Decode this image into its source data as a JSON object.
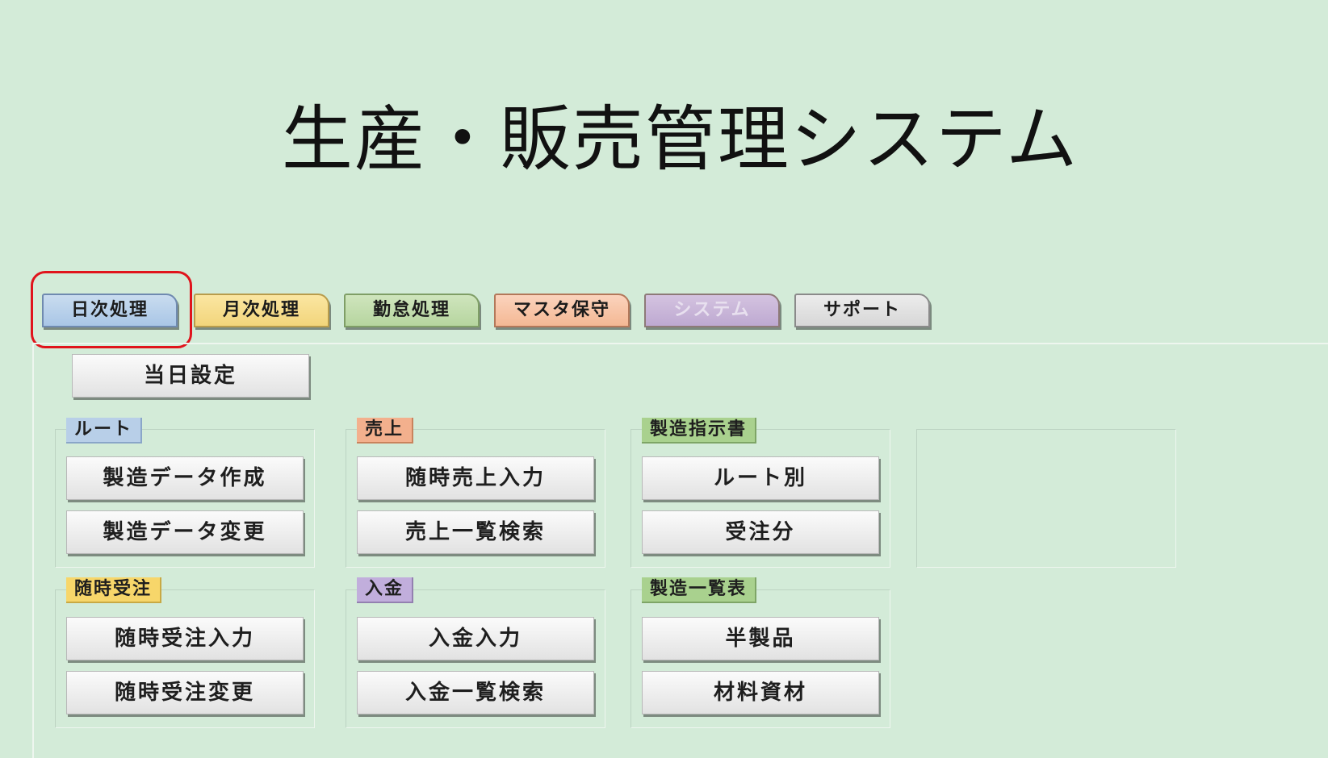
{
  "app": {
    "title": "生産・販売管理システム"
  },
  "tabs": [
    {
      "label": "日次処理"
    },
    {
      "label": "月次処理"
    },
    {
      "label": "勤怠処理"
    },
    {
      "label": "マスタ保守"
    },
    {
      "label": "システム"
    },
    {
      "label": "サポート"
    }
  ],
  "main": {
    "set_today_label": "当日設定",
    "groups": {
      "route": {
        "label": "ルート",
        "buttons": [
          "製造データ作成",
          "製造データ変更"
        ]
      },
      "sales": {
        "label": "売上",
        "buttons": [
          "随時売上入力",
          "売上一覧検索"
        ]
      },
      "manufacturing_instructions": {
        "label": "製造指示書",
        "buttons": [
          "ルート別",
          "受注分"
        ]
      },
      "ad_hoc_orders": {
        "label": "随時受注",
        "buttons": [
          "随時受注入力",
          "随時受注変更"
        ]
      },
      "payment": {
        "label": "入金",
        "buttons": [
          "入金入力",
          "入金一覧検索"
        ]
      },
      "manufacturing_list": {
        "label": "製造一覧表",
        "buttons": [
          "半製品",
          "材料資材"
        ]
      }
    }
  },
  "colors": {
    "background": "#d3ebd8",
    "highlight": "#e0141c",
    "tab_daily": "#b8cfe8",
    "tab_monthly": "#f7d66a",
    "tab_attendance": "#a9d18e",
    "tab_master": "#f3b08d",
    "tab_system": "#c1aedc",
    "tab_support": "#e0e0e0"
  }
}
